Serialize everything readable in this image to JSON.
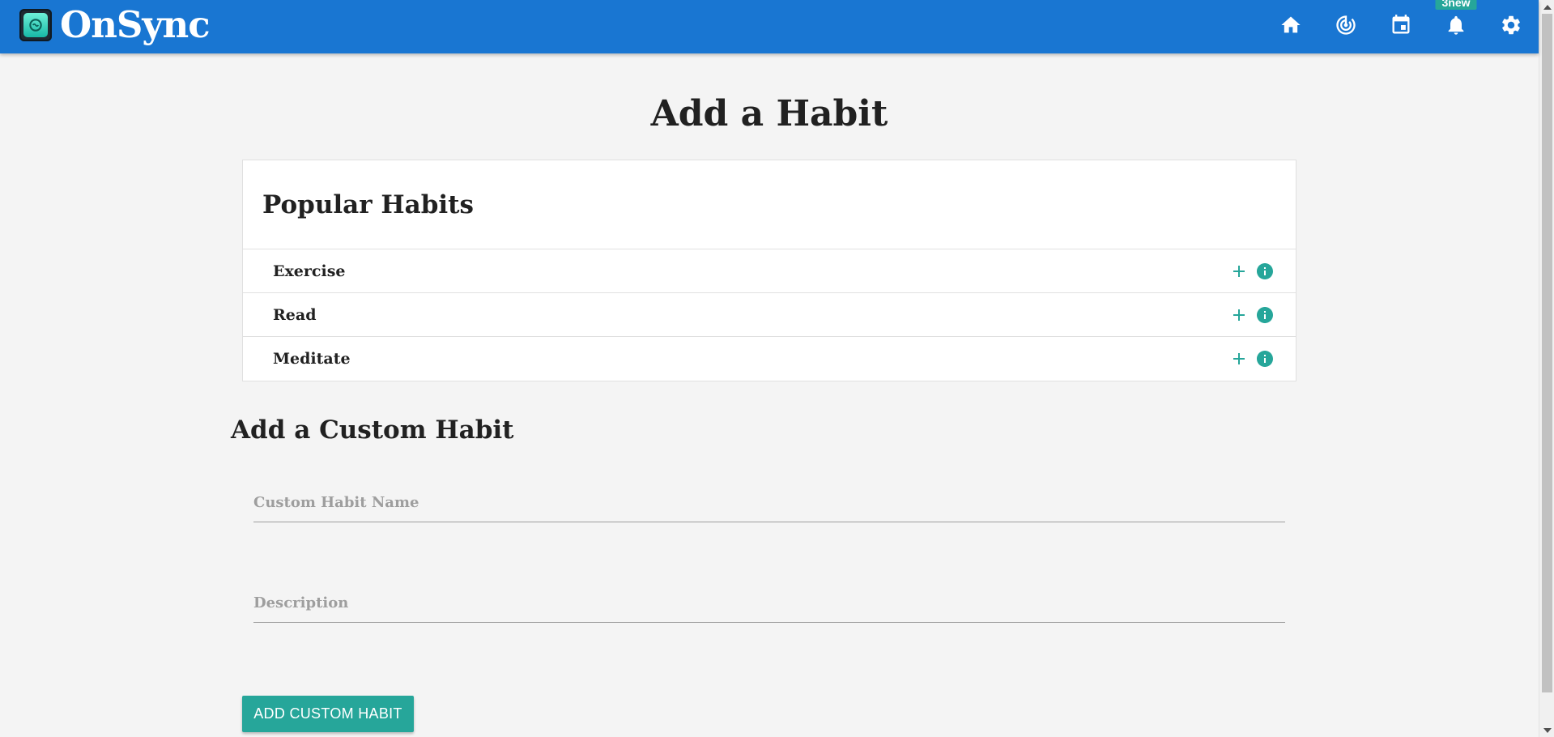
{
  "app": {
    "name": "OnSync",
    "logo_icon": "onsync-logo-icon",
    "accent_color": "#26a69a",
    "navbar_color": "#1976d2"
  },
  "nav": {
    "items": [
      {
        "name": "home-icon"
      },
      {
        "name": "track-changes-icon"
      },
      {
        "name": "calendar-icon"
      },
      {
        "name": "notifications-icon",
        "badge": "3new"
      },
      {
        "name": "settings-icon"
      }
    ]
  },
  "page": {
    "title": "Add a Habit"
  },
  "popular": {
    "header": "Popular Habits",
    "items": [
      {
        "label": "Exercise",
        "add_icon": "add-icon",
        "info_icon": "info-icon"
      },
      {
        "label": "Read",
        "add_icon": "add-icon",
        "info_icon": "info-icon"
      },
      {
        "label": "Meditate",
        "add_icon": "add-icon",
        "info_icon": "info-icon"
      }
    ]
  },
  "custom": {
    "title": "Add a Custom Habit",
    "name_placeholder": "Custom Habit Name",
    "name_value": "",
    "description_placeholder": "Description",
    "description_value": "",
    "submit_label": "ADD CUSTOM HABIT"
  }
}
